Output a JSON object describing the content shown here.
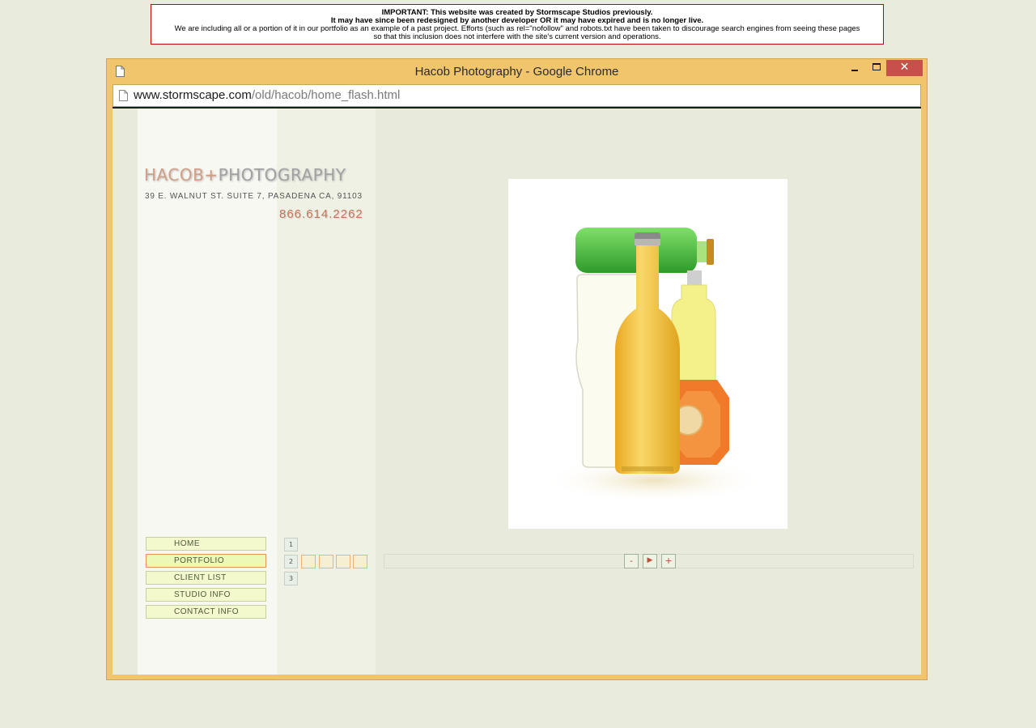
{
  "notice": {
    "line1": "IMPORTANT: This website was created by Stormscape Studios previously.",
    "line2": "It may have since been redesigned by another developer OR it may have expired and is no longer live.",
    "line3": "We are including all or a portion of it in our portfolio as an example of a past project. Efforts (such as rel=\"nofollow\" and robots.txt have been taken to discourage search engines from seeing these pages",
    "line4": "so that this inclusion does not interfere with the site's current version and operations."
  },
  "window": {
    "title": "Hacob Photography - Google Chrome",
    "close_glyph": "✕"
  },
  "address": {
    "host": "www.stormscape.com",
    "path": "/old/hacob/home_flash.html"
  },
  "site": {
    "logo_a": "HACOB",
    "logo_plus": "+",
    "logo_b": "PHOTOGRAPHY",
    "address": "39 E. WALNUT ST. SUITE 7, PASADENA CA, 91103",
    "phone": "866.614.2262",
    "nav": [
      "HOME",
      "PORTFOLIO",
      "CLIENT LIST",
      "STUDIO INFO",
      "CONTACT INFO"
    ],
    "active_nav": "PORTFOLIO",
    "pages": [
      "1",
      "2",
      "3"
    ],
    "controls": {
      "prev": "-",
      "play": "▶",
      "next": "+"
    }
  },
  "colors": {
    "window_frame": "#f0c56b",
    "close_button": "#c7504a",
    "nav_active_border": "#e19658",
    "phone": "#c5765a"
  }
}
